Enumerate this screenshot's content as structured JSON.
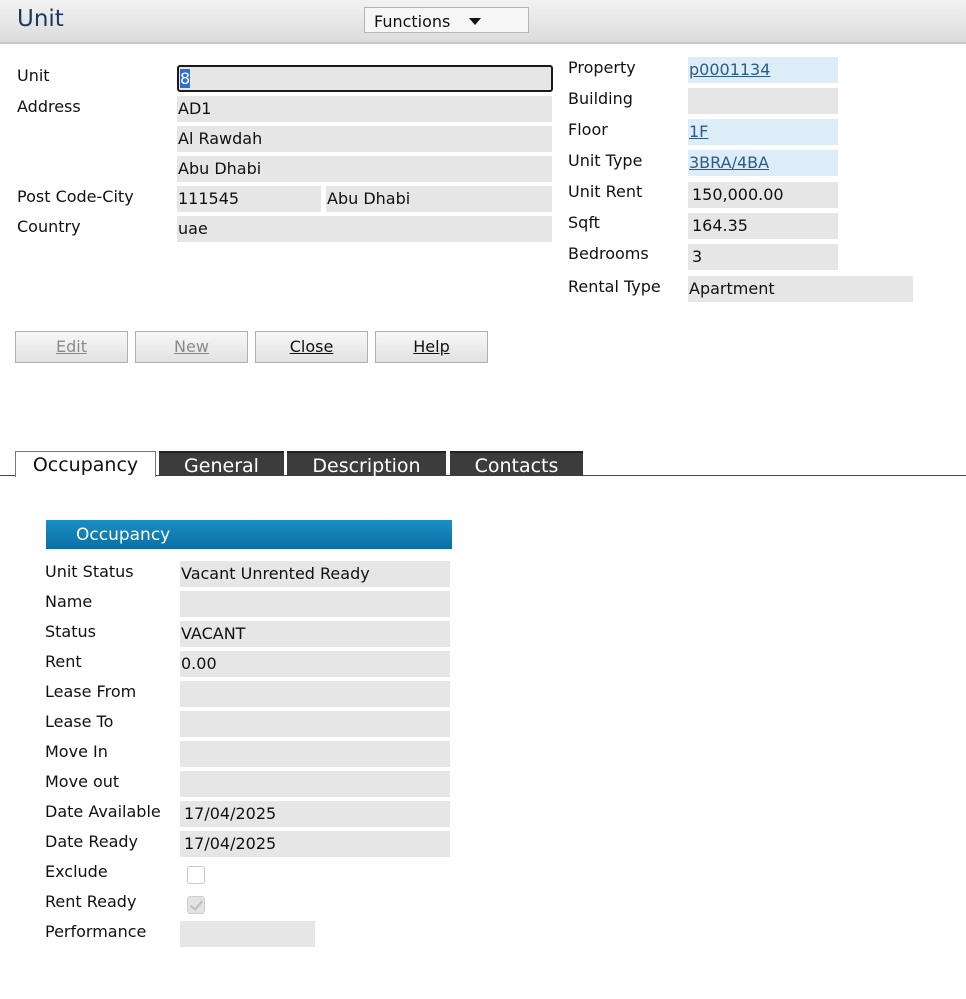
{
  "header": {
    "title": "Unit",
    "functions_label": "Functions"
  },
  "unit_form": {
    "unit": {
      "label": "Unit",
      "value": "8"
    },
    "address": {
      "label": "Address",
      "line1": "AD1",
      "line2": "Al Rawdah",
      "line3": "Abu Dhabi"
    },
    "postcode_city": {
      "label": "Post Code-City",
      "postcode": "111545",
      "city": "Abu Dhabi"
    },
    "country": {
      "label": "Country",
      "value": "uae"
    },
    "property": {
      "label": "Property",
      "value": "p0001134"
    },
    "building": {
      "label": "Building",
      "value": ""
    },
    "floor": {
      "label": "Floor",
      "value": "1F"
    },
    "unit_type": {
      "label": "Unit Type",
      "value": "3BRA/4BA"
    },
    "unit_rent": {
      "label": "Unit Rent",
      "value": "150,000.00"
    },
    "sqft": {
      "label": "Sqft",
      "value": "164.35"
    },
    "bedrooms": {
      "label": "Bedrooms",
      "value": "3"
    },
    "rental_type": {
      "label": "Rental Type",
      "value": "Apartment"
    }
  },
  "buttons": {
    "edit": {
      "label": "Edit",
      "disabled": true
    },
    "new": {
      "label": "New",
      "disabled": true
    },
    "close": {
      "label": "Close"
    },
    "help": {
      "label": "Help"
    }
  },
  "tabs": [
    {
      "label": "Occupancy",
      "active": true
    },
    {
      "label": "General"
    },
    {
      "label": "Description"
    },
    {
      "label": "Contacts"
    }
  ],
  "occupancy": {
    "heading": "Occupancy",
    "unit_status": {
      "label": "Unit Status",
      "value": "Vacant Unrented Ready"
    },
    "name": {
      "label": "Name",
      "value": ""
    },
    "status": {
      "label": "Status",
      "value": "VACANT"
    },
    "rent": {
      "label": "Rent",
      "value": "0.00"
    },
    "lease_from": {
      "label": "Lease From",
      "value": ""
    },
    "lease_to": {
      "label": "Lease To",
      "value": ""
    },
    "move_in": {
      "label": "Move In",
      "value": ""
    },
    "move_out": {
      "label": "Move out",
      "value": ""
    },
    "date_available": {
      "label": "Date Available",
      "value": "17/04/2025"
    },
    "date_ready": {
      "label": "Date Ready",
      "value": "17/04/2025"
    },
    "exclude": {
      "label": "Exclude",
      "checked": false
    },
    "rent_ready": {
      "label": "Rent Ready",
      "checked": true
    },
    "performance": {
      "label": "Performance",
      "value": ""
    }
  }
}
